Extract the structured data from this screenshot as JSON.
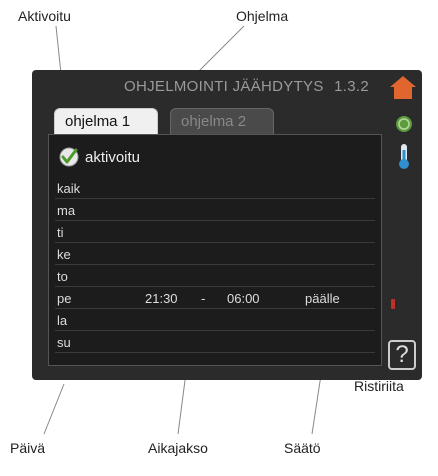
{
  "callouts": {
    "activated": "Aktivoitu",
    "program": "Ohjelma",
    "conflict": "Ristiriita",
    "day": "Päivä",
    "time_period": "Aikajakso",
    "setting": "Säätö"
  },
  "screen": {
    "title": "OHJELMOINTI JÄÄHDYTYS",
    "menu_number": "1.3.2",
    "tabs": [
      {
        "label": "ohjelma 1",
        "active": true
      },
      {
        "label": "ohjelma 2",
        "active": false
      }
    ],
    "activated_label": "aktivoitu",
    "days": [
      {
        "name": "kaik",
        "start": "",
        "sep": "",
        "end": "",
        "setting": ""
      },
      {
        "name": "ma",
        "start": "",
        "sep": "",
        "end": "",
        "setting": ""
      },
      {
        "name": "ti",
        "start": "",
        "sep": "",
        "end": "",
        "setting": ""
      },
      {
        "name": "ke",
        "start": "",
        "sep": "",
        "end": "",
        "setting": ""
      },
      {
        "name": "to",
        "start": "",
        "sep": "",
        "end": "",
        "setting": ""
      },
      {
        "name": "pe",
        "start": "21:30",
        "sep": "-",
        "end": "06:00",
        "setting": "päälle"
      },
      {
        "name": "la",
        "start": "",
        "sep": "",
        "end": "",
        "setting": ""
      },
      {
        "name": "su",
        "start": "",
        "sep": "",
        "end": "",
        "setting": ""
      }
    ],
    "help_symbol": "?"
  },
  "colors": {
    "screen_bg": "#2b2b2b",
    "house_icon": "#e0652e",
    "status_icon": "#5c9c3c",
    "thermometer_icon": "#2f8fd0",
    "conflict_mark": "#c0302a"
  }
}
